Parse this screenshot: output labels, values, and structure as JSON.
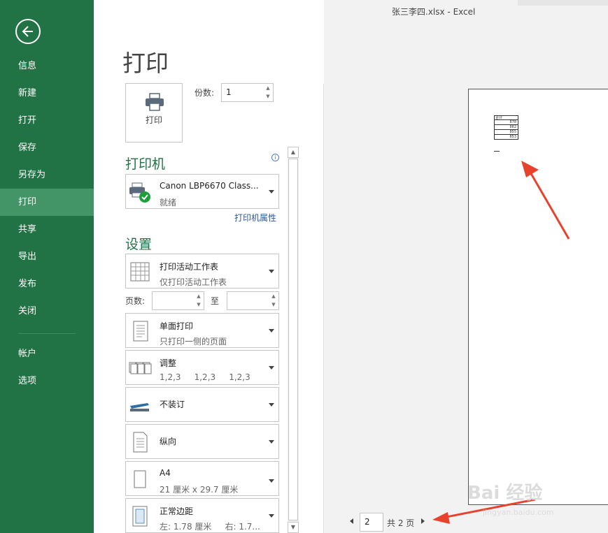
{
  "window": {
    "title": "张三李四.xlsx - Excel"
  },
  "sidebar": {
    "items": [
      {
        "label": "信息"
      },
      {
        "label": "新建"
      },
      {
        "label": "打开"
      },
      {
        "label": "保存"
      },
      {
        "label": "另存为"
      },
      {
        "label": "打印",
        "active": true
      },
      {
        "label": "共享"
      },
      {
        "label": "导出"
      },
      {
        "label": "发布"
      },
      {
        "label": "关闭"
      },
      {
        "label": "帐户"
      },
      {
        "label": "选项"
      }
    ]
  },
  "main": {
    "title": "打印",
    "print_button_label": "打印",
    "copies_label": "份数:",
    "copies_value": "1",
    "printer_heading": "打印机",
    "printer": {
      "name": "Canon LBP6670 Class...",
      "status": "就绪",
      "icon": "printer-ready-icon"
    },
    "printer_properties": "打印机属性",
    "settings_heading": "设置",
    "settings": [
      {
        "l1": "打印活动工作表",
        "l2": "仅打印活动工作表",
        "icon": "worksheet-grid-icon"
      },
      {
        "l1": "单面打印",
        "l2": "只打印一侧的页面",
        "icon": "single-sided-icon"
      },
      {
        "l1": "调整",
        "l2": "1,2,3     1,2,3     1,2,3",
        "icon": "collate-icon"
      },
      {
        "l1": "不装订",
        "l2": "",
        "icon": "stapler-icon"
      },
      {
        "l1": "纵向",
        "l2": "",
        "icon": "portrait-icon"
      },
      {
        "l1": "A4",
        "l2": "21 厘米 x 29.7 厘米",
        "icon": "paper-size-icon"
      },
      {
        "l1": "正常边距",
        "l2": "左: 1.78 厘米     右: 1.7...",
        "icon": "margins-icon"
      }
    ],
    "pages_label": "页数:",
    "to_label": "至",
    "pages_from": "",
    "pages_to": ""
  },
  "preview": {
    "table_rows": [
      "合计",
      "878",
      "882",
      "855",
      "853"
    ],
    "current_page": "2",
    "total_pages": "共 2 页"
  },
  "watermark": {
    "text": "Bai 经验",
    "sub": "jingyan.baidu.com"
  },
  "colors": {
    "sidebar": "#217346",
    "active": "#439467",
    "accent": "#217346",
    "annotation": "#e8412c"
  }
}
